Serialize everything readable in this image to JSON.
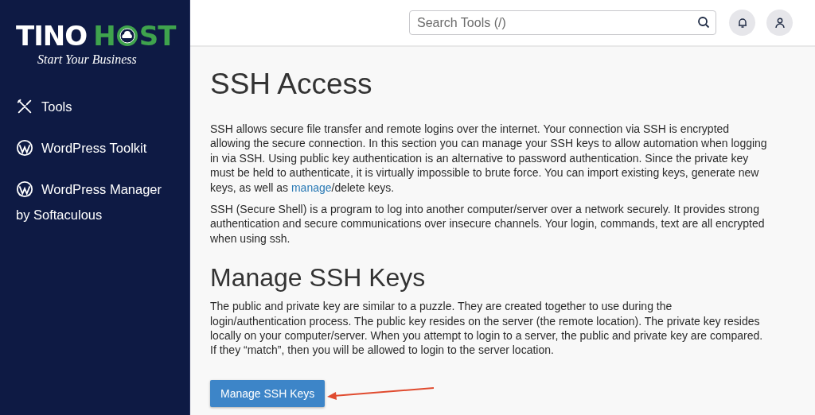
{
  "sidebar": {
    "logo": {
      "part_1": "TINO",
      "part_2": "H",
      "part_3": "ST",
      "tagline": "Start Your Business"
    },
    "items": [
      {
        "kind": "tools",
        "label": "Tools"
      },
      {
        "kind": "wordpress",
        "label": "WordPress Toolkit"
      },
      {
        "kind": "wordpress",
        "label": "WordPress Manager by Softaculous"
      }
    ]
  },
  "topbar": {
    "search": {
      "placeholder": "Search Tools (/)"
    }
  },
  "content": {
    "title": "SSH Access",
    "intro": {
      "text_before": "SSH allows secure file transfer and remote logins over the internet. Your connection via SSH is encrypted allowing the secure connection. In this section you can manage your SSH keys to allow automation when logging in via SSH. Using public key authentication is an alternative to password authentication. Since the private key must be held to authenticate, it is virtually impossible to brute force. You can import existing keys, generate new keys, as well as ",
      "link": "manage",
      "text_after": "/delete keys."
    },
    "paragraph": "SSH (Secure Shell) is a program to log into another computer/server over a network securely. It provides strong authentication and secure communications over insecure channels. Your login, commands, text are all encrypted when using ssh.",
    "section_title": "Manage SSH Keys",
    "section_text": "The public and private key are similar to a puzzle. They are created together to use during the login/authentication process. The public key resides on the server (the remote location). The private key resides locally on your computer/server. When you attempt to login to a server, the public and private key are compared. If they “match”, then you will be allowed to login to the server location.",
    "button": "Manage SSH Keys"
  }
}
